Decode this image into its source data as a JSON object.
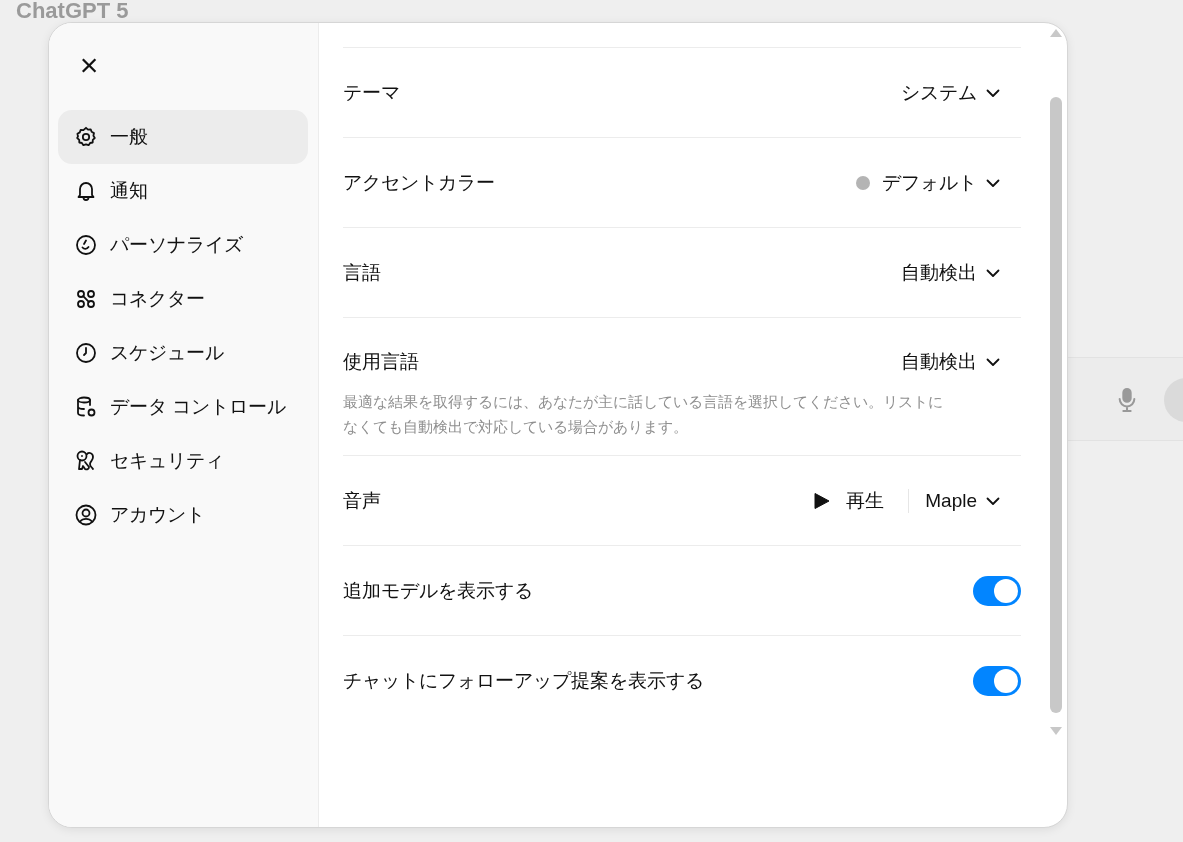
{
  "background": {
    "title": "ChatGPT 5"
  },
  "sidebar": {
    "close_label": "×",
    "items": [
      {
        "label": "一般",
        "selected": true
      },
      {
        "label": "通知",
        "selected": false
      },
      {
        "label": "パーソナライズ",
        "selected": false
      },
      {
        "label": "コネクター",
        "selected": false
      },
      {
        "label": "スケジュール",
        "selected": false
      },
      {
        "label": "データ コントロール",
        "selected": false
      },
      {
        "label": "セキュリティ",
        "selected": false
      },
      {
        "label": "アカウント",
        "selected": false
      }
    ]
  },
  "settings": [
    {
      "kind": "select",
      "label": "テーマ",
      "value": "システム"
    },
    {
      "kind": "select",
      "label": "アクセントカラー",
      "value": "デフォルト",
      "color": "#b4b4b4"
    },
    {
      "kind": "select",
      "label": "言語",
      "value": "自動検出"
    },
    {
      "kind": "select",
      "label": "使用言語",
      "value": "自動検出",
      "description": "最適な結果を取得するには、あなたが主に話している言語を選択してください。リストになくても自動検出で対応している場合があります。"
    },
    {
      "kind": "voice",
      "label": "音声",
      "play_label": "再生",
      "value": "Maple"
    },
    {
      "kind": "toggle",
      "label": "追加モデルを表示する",
      "on": true
    },
    {
      "kind": "toggle",
      "label": "チャットにフォローアップ提案を表示する",
      "on": true
    }
  ]
}
